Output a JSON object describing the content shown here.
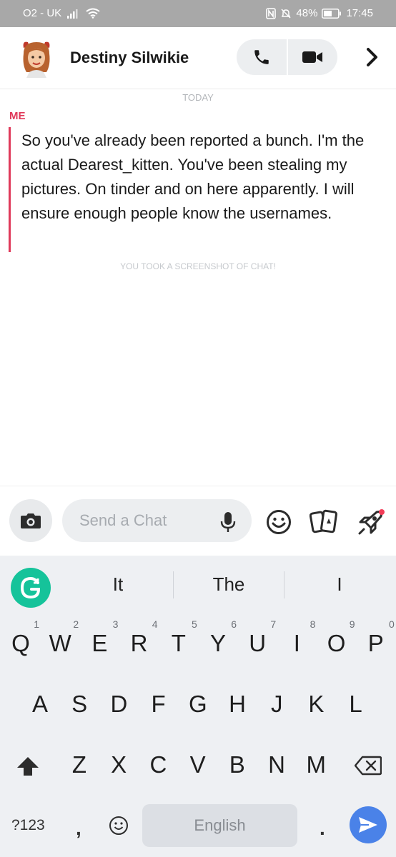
{
  "status_bar": {
    "carrier": "O2 - UK",
    "battery": "48%",
    "time": "17:45"
  },
  "header": {
    "contact_name": "Destiny Silwikie",
    "icons": [
      "avatar",
      "phone-icon",
      "video-icon",
      "chevron-right-icon"
    ]
  },
  "messages": {
    "date_label": "TODAY",
    "sender": "ME",
    "text": "So you've already been reported a bunch. I'm the actual Dearest_kitten. You've been stealing my pictures. On tinder and on here apparently. I will ensure enough people know the usernames.",
    "event": "YOU TOOK A SCREENSHOT OF CHAT!"
  },
  "compose": {
    "placeholder": "Send a Chat",
    "value": "",
    "icons": [
      "camera-icon",
      "mic-icon",
      "smiley-icon",
      "cards-icon",
      "rocket-icon"
    ],
    "notification_dot_color": "#f23c57"
  },
  "keyboard": {
    "suggestions": [
      "It",
      "The",
      "I"
    ],
    "row1": [
      "Q",
      "W",
      "E",
      "R",
      "T",
      "Y",
      "U",
      "I",
      "O",
      "P"
    ],
    "row1_numbers": [
      "1",
      "2",
      "3",
      "4",
      "5",
      "6",
      "7",
      "8",
      "9",
      "0"
    ],
    "row2": [
      "A",
      "S",
      "D",
      "F",
      "G",
      "H",
      "J",
      "K",
      "L"
    ],
    "row3": [
      "Z",
      "X",
      "C",
      "V",
      "B",
      "N",
      "M"
    ],
    "symbols_key": "?123",
    "comma_key": ",",
    "space_label": "English",
    "period_key": ".",
    "accent_color": "#4a82e8",
    "grammarly_color": "#15c39a"
  }
}
